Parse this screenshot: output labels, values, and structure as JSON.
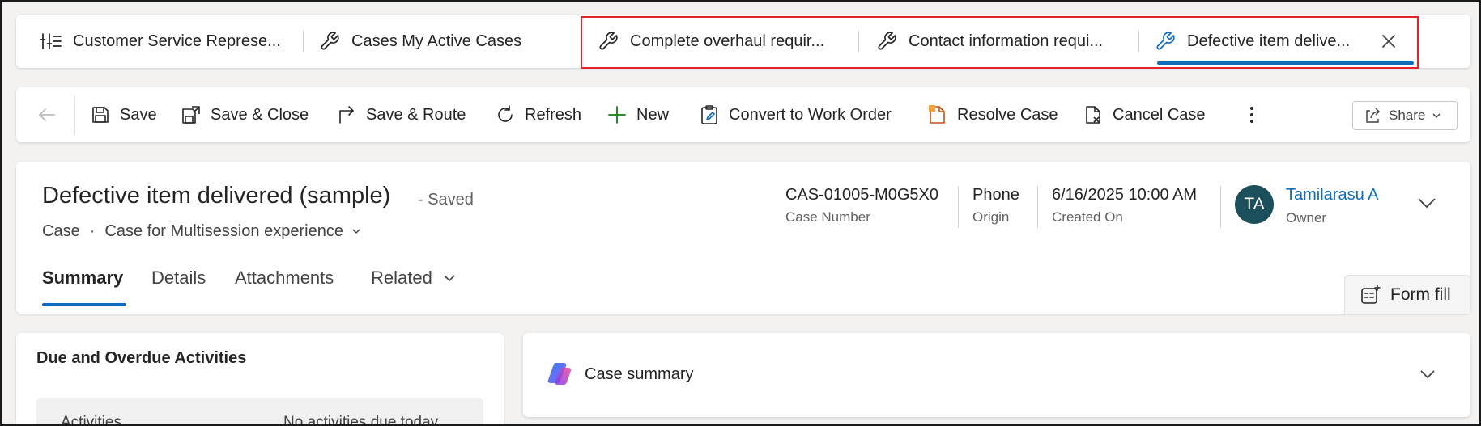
{
  "session_tabs": [
    {
      "label": "Customer Service Represe...",
      "icon": "dashboard-icon"
    },
    {
      "label": "Cases My Active Cases",
      "icon": "wrench-icon"
    },
    {
      "label": "Complete overhaul requir...",
      "icon": "wrench-icon"
    },
    {
      "label": "Contact information requi...",
      "icon": "wrench-icon"
    },
    {
      "label": "Defective item delive...",
      "icon": "wrench-icon",
      "active": true
    }
  ],
  "command_bar": {
    "save": "Save",
    "save_close": "Save & Close",
    "save_route": "Save & Route",
    "refresh": "Refresh",
    "new": "New",
    "convert": "Convert to Work Order",
    "resolve": "Resolve Case",
    "cancel": "Cancel Case",
    "share": "Share"
  },
  "record": {
    "title": "Defective item delivered (sample)",
    "saved_status": "- Saved",
    "entity": "Case",
    "form_name": "Case for Multisession experience",
    "fields": [
      {
        "value": "CAS-01005-M0G5X0",
        "label": "Case Number"
      },
      {
        "value": "Phone",
        "label": "Origin"
      },
      {
        "value": "6/16/2025 10:00 AM",
        "label": "Created On"
      }
    ],
    "owner": {
      "initials": "TA",
      "name": "Tamilarasu A",
      "label": "Owner"
    }
  },
  "form_tabs": [
    "Summary",
    "Details",
    "Attachments",
    "Related"
  ],
  "form_fill": "Form fill",
  "panels": {
    "due_activities": {
      "title": "Due and Overdue Activities",
      "key": "Activities",
      "value": "No activities due today"
    },
    "case_summary": {
      "title": "Case summary"
    }
  },
  "colors": {
    "accent": "#0f6cbd",
    "highlight": "#e8202a",
    "avatar": "#1b4f5c",
    "new_plus": "#107c10",
    "resolve": "#ca5010"
  }
}
